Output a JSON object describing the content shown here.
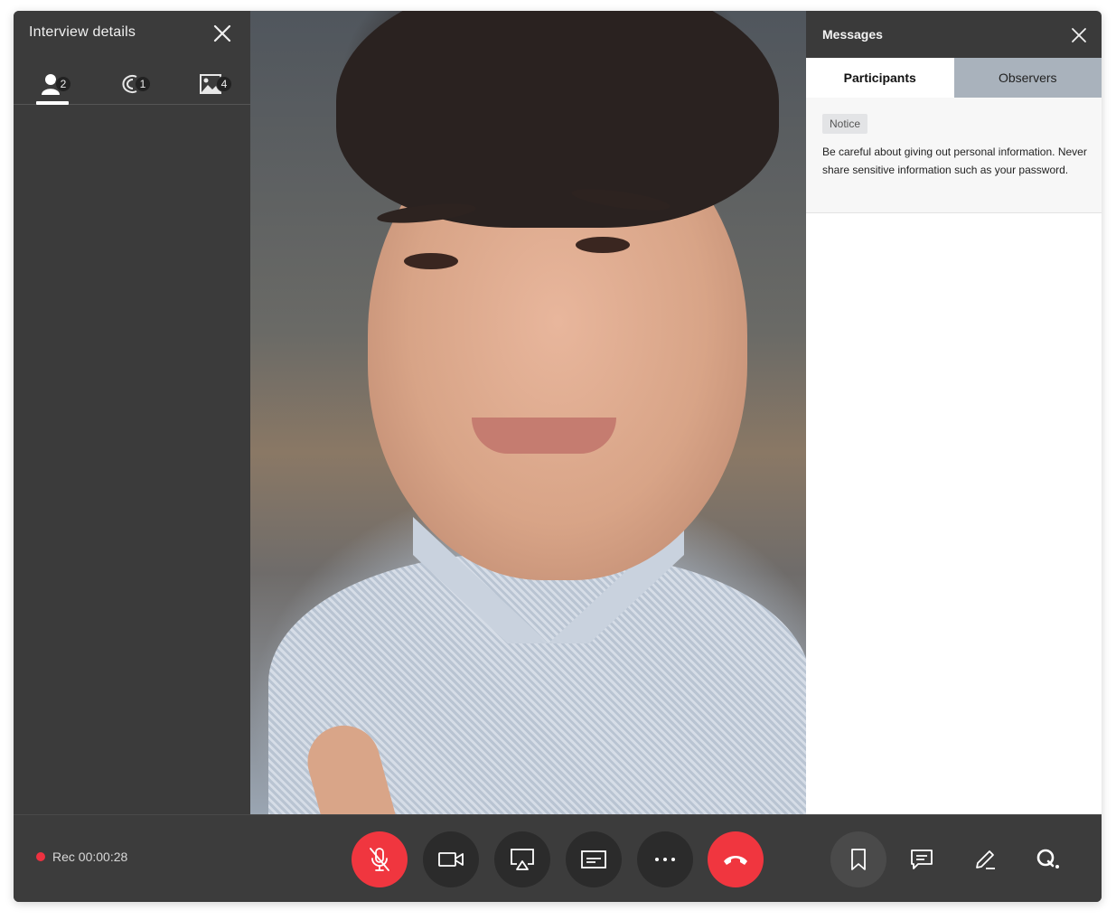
{
  "left_panel": {
    "title": "Interview details",
    "tabs": [
      {
        "icon": "person-icon",
        "count": "2"
      },
      {
        "icon": "eye-icon",
        "count": "1"
      },
      {
        "icon": "image-icon",
        "count": "4"
      }
    ]
  },
  "right_panel": {
    "title": "Messages",
    "tabs": [
      {
        "label": "Participants",
        "active": true
      },
      {
        "label": "Observers",
        "active": false
      }
    ],
    "notice": {
      "tag": "Notice",
      "text": "Be careful about giving out personal information. Never share sensitive information such as your password."
    }
  },
  "bottom_bar": {
    "recording": "Rec 00:00:28",
    "controls": [
      "mic-muted-icon",
      "video-camera-icon",
      "screen-share-icon",
      "captions-icon",
      "more-icon",
      "end-call-icon"
    ],
    "tools": [
      "bookmark-icon",
      "chat-icon",
      "pen-icon",
      "q-icon"
    ]
  },
  "colors": {
    "panel_dark": "#3b3b3b",
    "accent_red": "#f0363f",
    "inactive_tab": "#a9b2bc"
  }
}
